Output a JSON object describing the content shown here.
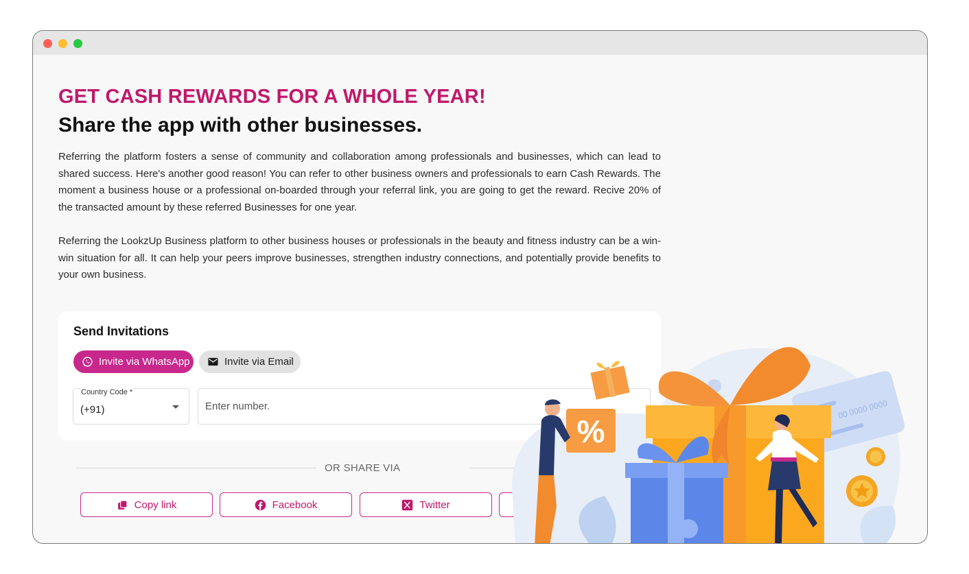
{
  "window": {
    "controls": [
      "close",
      "minimize",
      "maximize"
    ]
  },
  "hero": {
    "headline": "GET CASH REWARDS FOR A WHOLE YEAR!",
    "subheadline": "Share the app with other businesses.",
    "paragraph1": "Referring the platform fosters a sense of community and collaboration among professionals and businesses, which can lead to shared success. Here's another good reason! You can refer to other business owners and professionals to earn Cash Rewards. The moment a business house or a professional on-boarded through your referral link, you are going to get the reward. Recive 20% of the transacted amount by these referred Businesses for one year.",
    "paragraph2": "Referring the LookzUp Business platform to other business houses or professionals in the beauty and fitness industry can be a win-win situation for all. It can help your peers improve businesses, strengthen industry connections, and potentially provide benefits to your own business."
  },
  "invitations": {
    "title": "Send Invitations",
    "whatsapp_label": "Invite via WhatsApp",
    "email_label": "Invite via Email",
    "country_code_label": "Country Code *",
    "country_code_value": "(+91)",
    "number_placeholder": "Enter number."
  },
  "share": {
    "divider_text": "OR SHARE VIA",
    "copy_label": "Copy link",
    "facebook_label": "Facebook",
    "twitter_label": "Twitter"
  },
  "illustration": {
    "discount_text": "%",
    "card_text": "00 0000 0000"
  },
  "colors": {
    "brand": "#c0186b",
    "whatsapp_pill": "#c8288c",
    "email_pill": "#e2e2e2"
  }
}
